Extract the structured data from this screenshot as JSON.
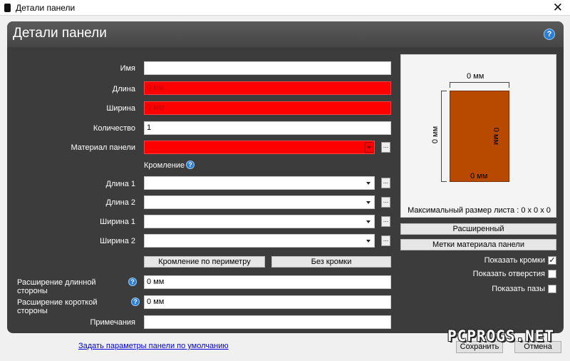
{
  "window": {
    "title": "Детали панели",
    "close_glyph": "✕"
  },
  "panel": {
    "title": "Детали панели",
    "help_glyph": "?"
  },
  "fields": {
    "name": {
      "label": "Имя",
      "value": ""
    },
    "length": {
      "label": "Длина",
      "value": "0 мм",
      "error": true
    },
    "width": {
      "label": "Ширина",
      "value": "0 мм",
      "error": true
    },
    "quantity": {
      "label": "Количество",
      "value": "1"
    },
    "material": {
      "label": "Материал панели",
      "value": "",
      "error": true,
      "browse": "..."
    }
  },
  "edging": {
    "section_label": "Кромление",
    "help_glyph": "?",
    "rows": [
      {
        "label": "Длина 1",
        "value": "",
        "browse": "..."
      },
      {
        "label": "Длина 2",
        "value": "",
        "browse": "..."
      },
      {
        "label": "Ширина 1",
        "value": "",
        "browse": "..."
      },
      {
        "label": "Ширина 2",
        "value": "",
        "browse": "..."
      }
    ],
    "perimeter_button": "Кромление по периметру",
    "no_edge_button": "Без кромки"
  },
  "extensions": {
    "long_side": {
      "label": "Расширение длинной стороны",
      "value": "0 мм",
      "help_glyph": "?"
    },
    "short_side": {
      "label": "Расширение короткой стороны",
      "value": "0 мм",
      "help_glyph": "?"
    }
  },
  "notes": {
    "label": "Примечания",
    "value": ""
  },
  "preview": {
    "top_dim": "0 мм",
    "left_dim": "0 мм",
    "right_dim": "0 мм",
    "bottom_dim": "0 мм",
    "max_sheet_size": "Максимальный размер листа  : 0 x 0 x 0",
    "sheet_color": "#b84a00"
  },
  "right_buttons": {
    "advanced": "Расширенный",
    "material_labels": "Метки материала панели"
  },
  "checkboxes": [
    {
      "label": "Показать кромки",
      "checked": true,
      "mark": "✓"
    },
    {
      "label": "Показать отверстия",
      "checked": false,
      "mark": ""
    },
    {
      "label": "Показать пазы",
      "checked": false,
      "mark": ""
    }
  ],
  "footer": {
    "default_link": "Задать параметры панели по умолчанию",
    "save": "Сохранить",
    "cancel": "Отмена"
  },
  "watermark": "PCPROGS.NET",
  "colors": {
    "panel_bg": "#3c3c3c",
    "error_red": "#ff0000",
    "help_blue": "#2a7fd4"
  }
}
